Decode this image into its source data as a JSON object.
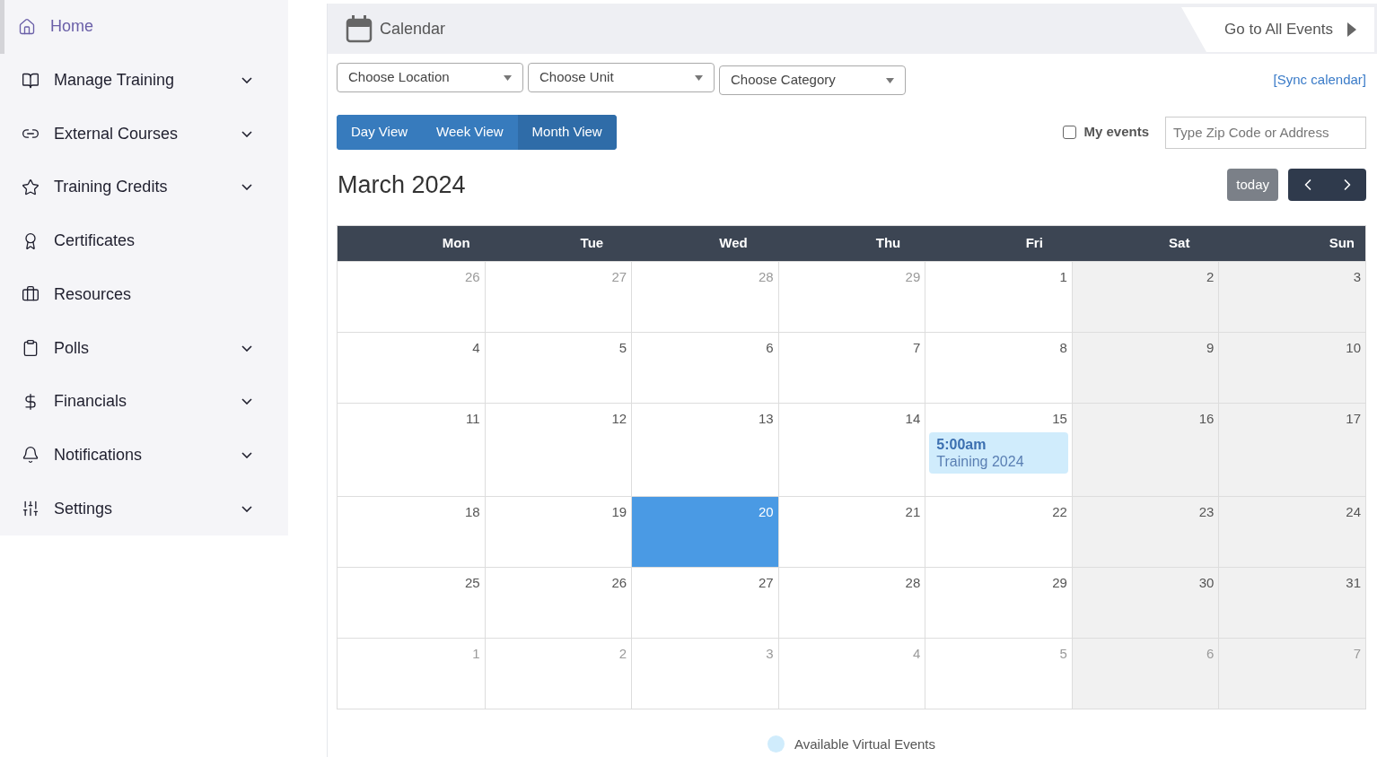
{
  "sidebar": {
    "items": [
      {
        "label": "Home",
        "selected": true,
        "expandable": false
      },
      {
        "label": "Manage Training",
        "selected": false,
        "expandable": true
      },
      {
        "label": "External Courses",
        "selected": false,
        "expandable": true
      },
      {
        "label": "Training Credits",
        "selected": false,
        "expandable": true
      },
      {
        "label": "Certificates",
        "selected": false,
        "expandable": false
      },
      {
        "label": "Resources",
        "selected": false,
        "expandable": false
      },
      {
        "label": "Polls",
        "selected": false,
        "expandable": true
      },
      {
        "label": "Financials",
        "selected": false,
        "expandable": true
      },
      {
        "label": "Notifications",
        "selected": false,
        "expandable": true
      },
      {
        "label": "Settings",
        "selected": false,
        "expandable": true
      }
    ]
  },
  "header": {
    "title": "Calendar",
    "link": "Go to All Events"
  },
  "filters": [
    "Choose Location",
    "Choose Unit",
    "Choose Category"
  ],
  "sync_link": "[Sync calendar]",
  "views": [
    {
      "label": "Day View",
      "selected": false
    },
    {
      "label": "Week View",
      "selected": false
    },
    {
      "label": "Month View",
      "selected": true
    }
  ],
  "my_events": {
    "label": "My events",
    "checked": false
  },
  "location_search": {
    "placeholder": "Type Zip Code or Address"
  },
  "month_title": "March 2024",
  "today_button": "today",
  "weekdays": [
    "Mon",
    "Tue",
    "Wed",
    "Thu",
    "Fri",
    "Sat",
    "Sun"
  ],
  "weeks": [
    [
      {
        "day": "26",
        "other_month": true,
        "today": false
      },
      {
        "day": "27",
        "other_month": true,
        "today": false
      },
      {
        "day": "28",
        "other_month": true,
        "today": false
      },
      {
        "day": "29",
        "other_month": true,
        "today": false
      },
      {
        "day": "1",
        "other_month": false,
        "today": false
      },
      {
        "day": "2",
        "other_month": false,
        "today": false
      },
      {
        "day": "3",
        "other_month": false,
        "today": false
      }
    ],
    [
      {
        "day": "4",
        "other_month": false,
        "today": false
      },
      {
        "day": "5",
        "other_month": false,
        "today": false
      },
      {
        "day": "6",
        "other_month": false,
        "today": false
      },
      {
        "day": "7",
        "other_month": false,
        "today": false
      },
      {
        "day": "8",
        "other_month": false,
        "today": false
      },
      {
        "day": "9",
        "other_month": false,
        "today": false
      },
      {
        "day": "10",
        "other_month": false,
        "today": false
      }
    ],
    [
      {
        "day": "11",
        "other_month": false,
        "today": false
      },
      {
        "day": "12",
        "other_month": false,
        "today": false
      },
      {
        "day": "13",
        "other_month": false,
        "today": false
      },
      {
        "day": "14",
        "other_month": false,
        "today": false
      },
      {
        "day": "15",
        "other_month": false,
        "today": false,
        "events": [
          {
            "time": "5:00am",
            "title": "Training 2024",
            "color": "#d0ecfc"
          }
        ]
      },
      {
        "day": "16",
        "other_month": false,
        "today": false
      },
      {
        "day": "17",
        "other_month": false,
        "today": false
      }
    ],
    [
      {
        "day": "18",
        "other_month": false,
        "today": false
      },
      {
        "day": "19",
        "other_month": false,
        "today": false
      },
      {
        "day": "20",
        "other_month": false,
        "today": true
      },
      {
        "day": "21",
        "other_month": false,
        "today": false
      },
      {
        "day": "22",
        "other_month": false,
        "today": false
      },
      {
        "day": "23",
        "other_month": false,
        "today": false
      },
      {
        "day": "24",
        "other_month": false,
        "today": false
      }
    ],
    [
      {
        "day": "25",
        "other_month": false,
        "today": false
      },
      {
        "day": "26",
        "other_month": false,
        "today": false
      },
      {
        "day": "27",
        "other_month": false,
        "today": false
      },
      {
        "day": "28",
        "other_month": false,
        "today": false
      },
      {
        "day": "29",
        "other_month": false,
        "today": false
      },
      {
        "day": "30",
        "other_month": false,
        "today": false
      },
      {
        "day": "31",
        "other_month": false,
        "today": false
      }
    ],
    [
      {
        "day": "1",
        "other_month": true,
        "today": false
      },
      {
        "day": "2",
        "other_month": true,
        "today": false
      },
      {
        "day": "3",
        "other_month": true,
        "today": false
      },
      {
        "day": "4",
        "other_month": true,
        "today": false
      },
      {
        "day": "5",
        "other_month": true,
        "today": false
      },
      {
        "day": "6",
        "other_month": true,
        "today": false
      },
      {
        "day": "7",
        "other_month": true,
        "today": false
      }
    ]
  ],
  "legend": [
    {
      "label": "Available Virtual Events",
      "color": "#d0ecfc"
    }
  ]
}
